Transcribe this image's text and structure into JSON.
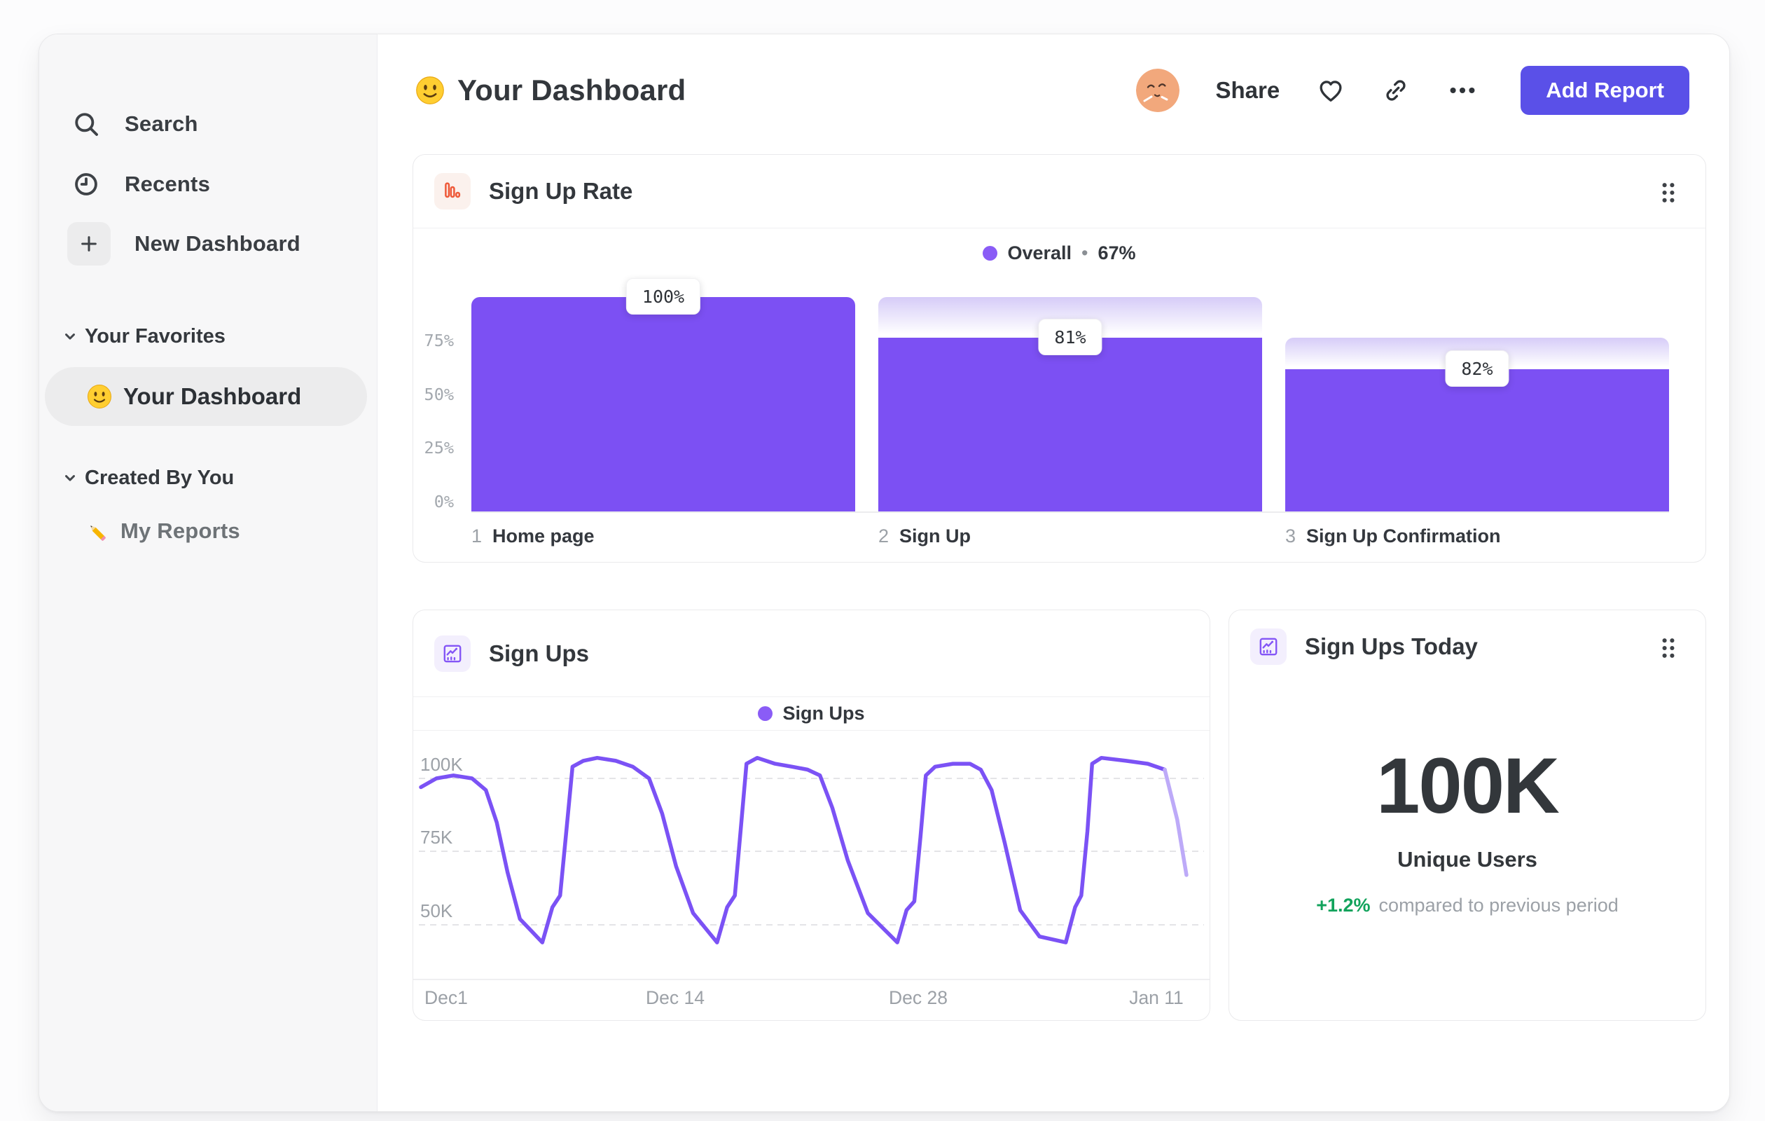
{
  "colors": {
    "accent_purple": "#7C50F3",
    "bar_gradient_top": "#D6CCF8",
    "legend_dot": "#8A5CF6",
    "line": "#7B52F5",
    "line_tail": "#BDAAF8",
    "button": "#5A50E8",
    "green": "#12A35C",
    "orange_icon": "#EE5A3A"
  },
  "icons": {
    "sidebar": [
      "search-icon",
      "clock-icon",
      "plus-icon"
    ],
    "header": [
      "avatar",
      "heart-icon",
      "link-icon",
      "ellipsis-icon"
    ],
    "cards": [
      "bar-chart-icon",
      "line-chart-icon",
      "drag-handle-icon"
    ],
    "emoji": [
      "smiley-emoji",
      "pencil-emoji"
    ]
  },
  "sidebar": {
    "search": "Search",
    "recents": "Recents",
    "new_dashboard": "New Dashboard",
    "your_favorites": "Your Favorites",
    "your_dashboard": "Your Dashboard",
    "created_by_you": "Created By You",
    "my_reports": "My Reports"
  },
  "header": {
    "title": "Your Dashboard",
    "share": "Share",
    "add_report": "Add Report"
  },
  "chart_data": [
    {
      "type": "bar",
      "subtype": "funnel",
      "title": "Sign Up Rate",
      "legend": {
        "name": "Overall",
        "sep": "•",
        "value": "67%"
      },
      "yticks": [
        "75%",
        "50%",
        "25%",
        "0%"
      ],
      "ylim": [
        0,
        100
      ],
      "categories": [
        "Home page",
        "Sign Up",
        "Sign Up Confirmation"
      ],
      "steps": [
        {
          "index": "1",
          "category": "Home page",
          "chip": "100%",
          "overall_pct": 100,
          "prev_pct": 100
        },
        {
          "index": "2",
          "category": "Sign Up",
          "chip": "81%",
          "overall_pct": 81,
          "prev_pct": 100
        },
        {
          "index": "3",
          "category": "Sign Up Confirmation",
          "chip": "82%",
          "overall_pct": 66.4,
          "prev_pct": 81
        }
      ]
    },
    {
      "type": "line",
      "title": "Sign Ups",
      "legend": "Sign Ups",
      "yticks": [
        "100K",
        "75K",
        "50K"
      ],
      "ytick_values": [
        100,
        75,
        50
      ],
      "xticks": [
        "Dec1",
        "Dec 14",
        "Dec 28",
        "Jan 11"
      ],
      "unit": "thousands",
      "points": [
        [
          0,
          97
        ],
        [
          20,
          100
        ],
        [
          42,
          101
        ],
        [
          66,
          100
        ],
        [
          84,
          96
        ],
        [
          98,
          85
        ],
        [
          112,
          68
        ],
        [
          128,
          52
        ],
        [
          157,
          44
        ],
        [
          170,
          56
        ],
        [
          180,
          60
        ],
        [
          188,
          82
        ],
        [
          196,
          104
        ],
        [
          210,
          106
        ],
        [
          228,
          107
        ],
        [
          252,
          106
        ],
        [
          274,
          104
        ],
        [
          295,
          100
        ],
        [
          312,
          88
        ],
        [
          330,
          70
        ],
        [
          352,
          54
        ],
        [
          383,
          44
        ],
        [
          396,
          56
        ],
        [
          406,
          60
        ],
        [
          414,
          84
        ],
        [
          421,
          105
        ],
        [
          435,
          107
        ],
        [
          458,
          105
        ],
        [
          480,
          104
        ],
        [
          500,
          103
        ],
        [
          516,
          101
        ],
        [
          532,
          90
        ],
        [
          552,
          72
        ],
        [
          578,
          54
        ],
        [
          616,
          44
        ],
        [
          628,
          55
        ],
        [
          638,
          58
        ],
        [
          646,
          80
        ],
        [
          653,
          101
        ],
        [
          665,
          104
        ],
        [
          688,
          105
        ],
        [
          710,
          105
        ],
        [
          724,
          103
        ],
        [
          738,
          96
        ],
        [
          755,
          78
        ],
        [
          775,
          55
        ],
        [
          800,
          46
        ],
        [
          834,
          44
        ],
        [
          846,
          56
        ],
        [
          854,
          60
        ],
        [
          862,
          82
        ],
        [
          868,
          105
        ],
        [
          880,
          107
        ],
        [
          912,
          106
        ],
        [
          940,
          105
        ],
        [
          962,
          103
        ],
        [
          978,
          86
        ],
        [
          990,
          67
        ]
      ],
      "light_tail_from": 55
    },
    {
      "type": "stat",
      "title": "Sign Ups Today",
      "value": "100K",
      "label": "Unique Users",
      "delta": "+1.2%",
      "delta_note": "compared to previous period"
    }
  ]
}
